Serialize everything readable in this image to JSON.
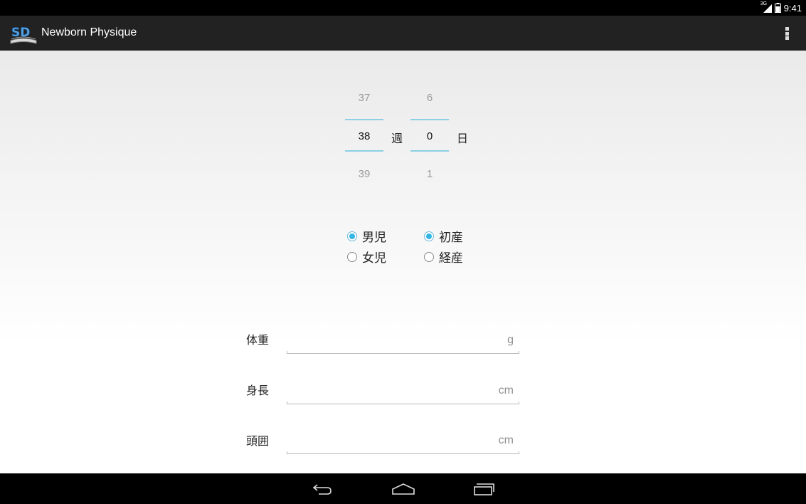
{
  "status_bar": {
    "network": "3G",
    "time": "9:41"
  },
  "action_bar": {
    "title": "Newborn Physique",
    "icon": "sd-app-icon",
    "menu_icon": "overflow-menu-icon"
  },
  "gestation": {
    "weeks": {
      "prev": "37",
      "current": "38",
      "next": "39",
      "unit": "週"
    },
    "days": {
      "prev": "6",
      "current": "0",
      "next": "1",
      "unit": "日"
    }
  },
  "sex": {
    "options": [
      {
        "label": "男児",
        "checked": true
      },
      {
        "label": "女児",
        "checked": false
      }
    ]
  },
  "parity": {
    "options": [
      {
        "label": "初産",
        "checked": true
      },
      {
        "label": "経産",
        "checked": false
      }
    ]
  },
  "measurements": [
    {
      "label": "体重",
      "value": "",
      "placeholder": "g"
    },
    {
      "label": "身長",
      "value": "",
      "placeholder": "cm"
    },
    {
      "label": "頭囲",
      "value": "",
      "placeholder": "cm"
    }
  ],
  "nav_bar": {
    "back_icon": "back-icon",
    "home_icon": "home-icon",
    "recents_icon": "recents-icon"
  },
  "colors": {
    "accent": "#33b5e5",
    "action_bar": "#222222"
  }
}
